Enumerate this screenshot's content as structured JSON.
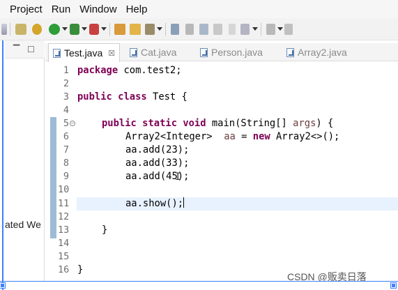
{
  "menu": {
    "items": [
      "Project",
      "Run",
      "Window",
      "Help"
    ]
  },
  "toolbar": {
    "icons": [
      "bookmark-icon",
      "settings-icon",
      "debug-icon",
      "run-icon",
      "profile-icon",
      "coverage-icon",
      "new-package-icon",
      "open-folder-icon",
      "pencil-icon",
      "pin-icon",
      "search-icon",
      "document-icon",
      "paragraph-icon",
      "annotation-icon",
      "navigate-icon"
    ]
  },
  "left_panel": {
    "visible_text": "ated We"
  },
  "tabs": [
    {
      "label": "Test.java",
      "active": true,
      "close_glyph": "☒"
    },
    {
      "label": "Cat.java",
      "active": false
    },
    {
      "label": "Person.java",
      "active": false
    },
    {
      "label": "Array2.java",
      "active": false
    }
  ],
  "editor": {
    "line_numbers": [
      "1",
      "2",
      "3",
      "4",
      "5",
      "6",
      "7",
      "8",
      "9",
      "10",
      "11",
      "12",
      "13",
      "14",
      "15",
      "16"
    ],
    "fold_glyph": "⊖",
    "lines": {
      "l1_kw": "package",
      "l1_rest": " com.test2;",
      "l3_kw": "public",
      "l3_kw2": "class",
      "l3_rest": " Test {",
      "l5_kw": "public",
      "l5_kw2": "static",
      "l5_kw3": "void",
      "l5_rest": " main(String[] ",
      "l5_param": "args",
      "l5_end": ") {",
      "l6_a": "Array2<Integer>  ",
      "l6_b": "aa",
      "l6_c": " = ",
      "l6_kw": "new",
      "l6_d": " Array2<>();",
      "l7": "aa.add(23);",
      "l8": "aa.add(33);",
      "l9": "aa.add(45);",
      "l11": "aa.show();",
      "l13": "}",
      "l15": "}"
    }
  },
  "watermark": "CSDN @贩卖日落",
  "colors": {
    "keyword": "#7f0055",
    "selection": "#3d7fff",
    "current_line": "#e8f2fe"
  }
}
